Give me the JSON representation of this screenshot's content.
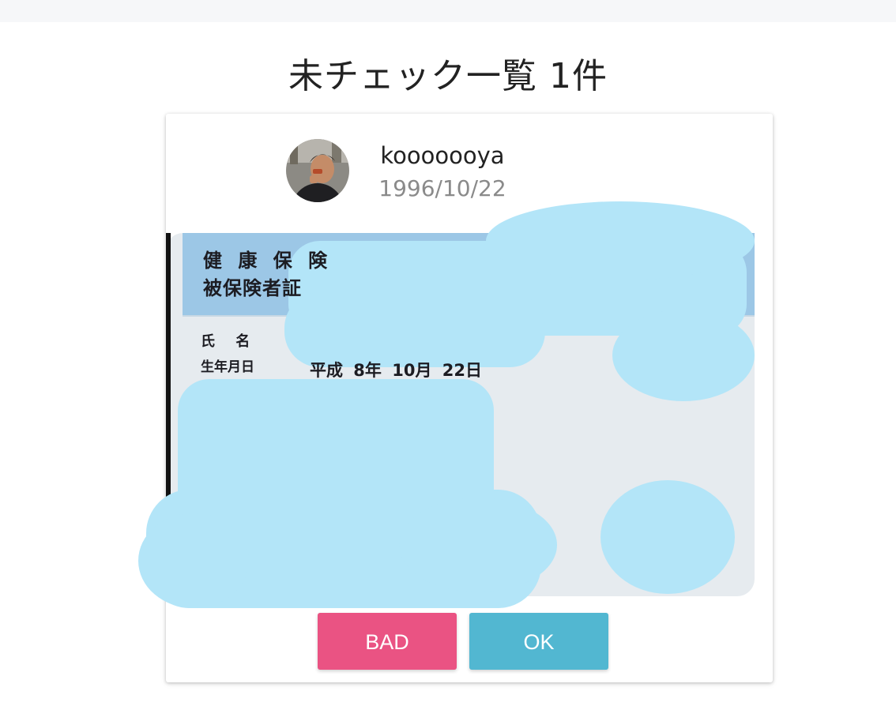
{
  "header": {
    "title": "未チェック一覧 1件"
  },
  "user": {
    "username": "kooooooya",
    "birthdate": "1996/10/22"
  },
  "id_card": {
    "title_line1": "健 康 保 険",
    "title_line2": "被保険者証",
    "name_label": "氏 名",
    "dob_label": "生年月日",
    "dob_value": "平成 8年 10月 22日"
  },
  "actions": {
    "bad_label": "BAD",
    "ok_label": "OK"
  },
  "colors": {
    "bad": "#ea5383",
    "ok": "#52b7d1",
    "censor": "#b3e5f8",
    "card_header": "#9cc7e6"
  }
}
